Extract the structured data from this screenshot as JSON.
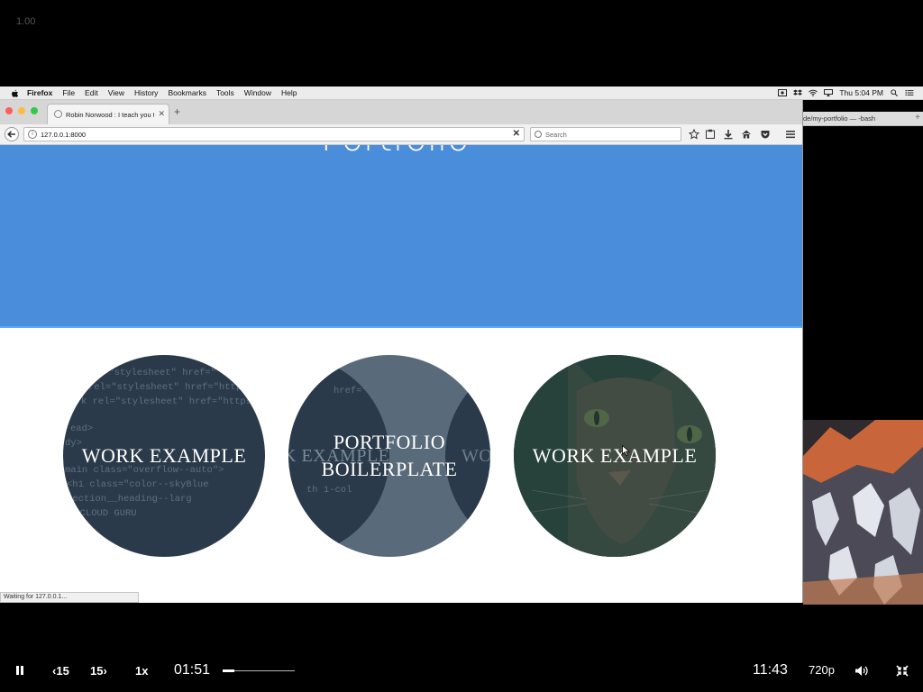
{
  "overlay": {
    "zoom_label": "1.00"
  },
  "menubar": {
    "app_name": "Firefox",
    "items": [
      "File",
      "Edit",
      "View",
      "History",
      "Bookmarks",
      "Tools",
      "Window",
      "Help"
    ],
    "clock": "Thu 5:04 PM"
  },
  "browser": {
    "tab_title": "Robin Norwood : I teach you t",
    "new_tab_symbol": "+",
    "url": "127.0.0.1:8000",
    "search_placeholder": "Search",
    "status_text": "Waiting for 127.0.0.1..."
  },
  "page": {
    "hero_title": "Portfolio",
    "cards": [
      {
        "label": "WORK EXAMPLE"
      },
      {
        "label_line1": "PORTFOLIO",
        "label_line2": "BOILERPLATE",
        "ghost_left": "K EXAMPLE",
        "ghost_right": "WO"
      },
      {
        "label": "WORK EXAMPLE"
      }
    ],
    "code_lines": [
      "=\"stylesheet\" href=\"",
      " rel=\"stylesheet\" href=\"https",
      "k rel=\"stylesheet\" href=\"https",
      "ead>",
      "dy>",
      "main class=\"overflow--auto\">",
      " <h1 class=\"color--skyBlue",
      "       section__heading--larg",
      "  A CLOUD GURU"
    ],
    "code_lines_card2": [
      "href=\"",
      "th 1-col"
    ]
  },
  "terminal": {
    "tab_title": "de/my-portfolio — -bash",
    "plus": "+"
  },
  "player": {
    "back_label": "15",
    "forward_label": "15",
    "speed": "1x",
    "current_time": "01:51",
    "total_time": "11:43",
    "quality": "720p",
    "progress_fraction": 0.16
  },
  "colors": {
    "hero": "#4a8edb",
    "card_overlay": "#2b3a4a",
    "card_overlay_cat": "#2e5048"
  }
}
